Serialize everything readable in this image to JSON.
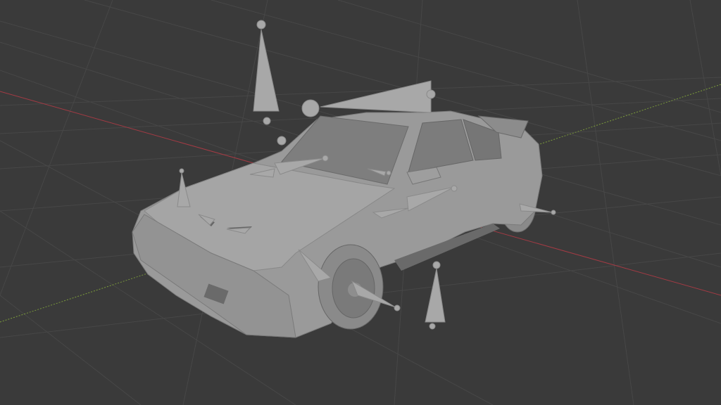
{
  "viewport": {
    "background": "#3a3a3a",
    "grid_color": "#4a4a4a",
    "x_axis_color": "#a33a44",
    "y_axis_color": "#7a9a3a",
    "model_color": "#9a9a9a",
    "model_shade": "#7d7d7d",
    "model_dark": "#5f5f5f",
    "bone_color": "#a6a6a6"
  },
  "scene": {
    "object": "car-model",
    "armature": "bone-rig",
    "bone_count": 14
  }
}
